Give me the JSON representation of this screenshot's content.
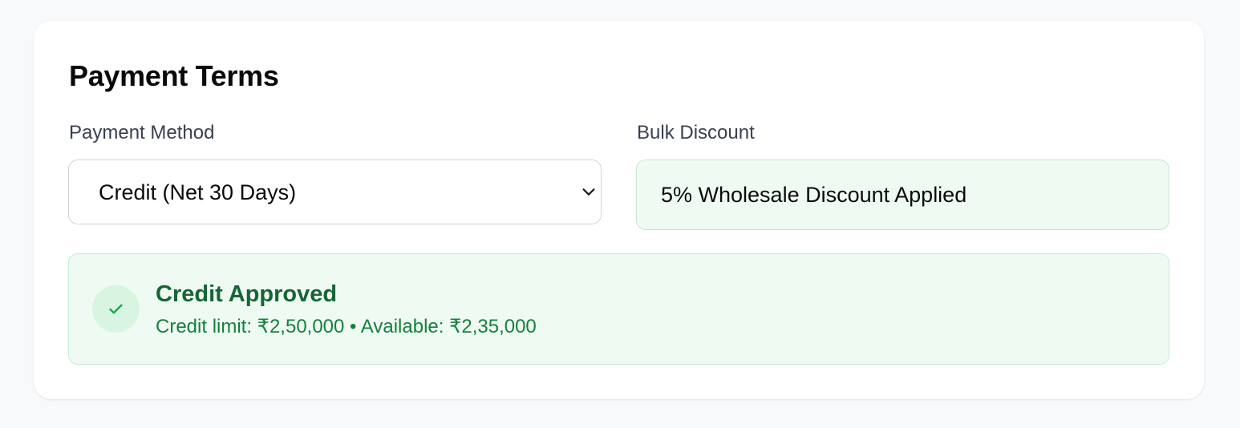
{
  "section": {
    "title": "Payment Terms"
  },
  "payment_method": {
    "label": "Payment Method",
    "selected": "Credit (Net 30 Days)",
    "icon": "chevron-down-icon"
  },
  "bulk_discount": {
    "label": "Bulk Discount",
    "value": "5% Wholesale Discount Applied"
  },
  "credit_status": {
    "icon": "check-icon",
    "title": "Credit Approved",
    "detail": "Credit limit: ₹2,50,000 • Available: ₹2,35,000"
  },
  "colors": {
    "success_text": "#166534",
    "success_bg": "#effbf2",
    "success_border": "#c6ebd3",
    "check_circle_bg": "#d7f5e0"
  }
}
